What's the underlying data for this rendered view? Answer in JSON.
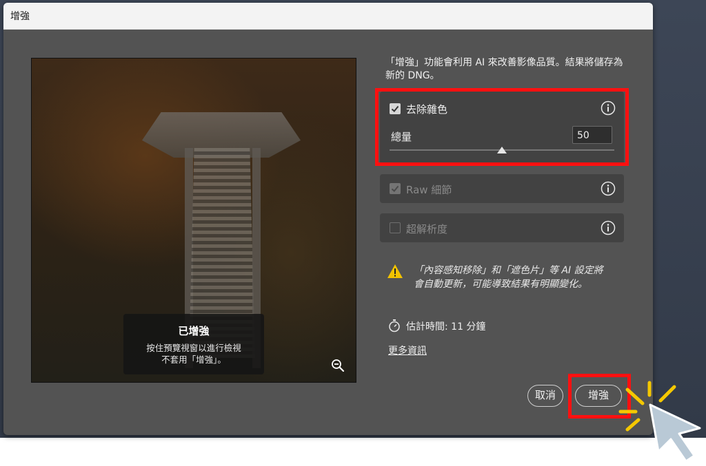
{
  "dialog": {
    "title": "增強"
  },
  "preview": {
    "badge_title": "已增強",
    "badge_subtitle_line1": "按住預覽視窗以進行檢視",
    "badge_subtitle_line2": "不套用「增強」。"
  },
  "description": "「增強」功能會利用 AI 來改善影像品質。結果將儲存為新的 DNG。",
  "options": {
    "denoise": {
      "label": "去除雜色",
      "checked": true,
      "enabled": true,
      "amount_label": "總量",
      "amount_value": "50",
      "slider_percent": 50
    },
    "raw_details": {
      "label": "Raw 細節",
      "checked": true,
      "enabled": false
    },
    "super_resolution": {
      "label": "超解析度",
      "checked": false,
      "enabled": false
    }
  },
  "warning": "「內容感知移除」和「遮色片」等 AI 設定將會自動更新，可能導致結果有明顯變化。",
  "estimate": "估計時間: 11 分鐘",
  "more_info": "更多資訊",
  "buttons": {
    "cancel": "取消",
    "enhance": "增強"
  },
  "colors": {
    "highlight": "#ff1010",
    "dialog_bg": "#535353",
    "panel_bg": "#424242",
    "warning": "#f2c200",
    "sparkle": "#f5c800",
    "cursor": "#b9c9d6"
  },
  "icons": {
    "info": "info-circle-icon",
    "warning": "warning-triangle-icon",
    "timer": "stopwatch-icon",
    "zoom": "zoom-out-icon",
    "check": "checkmark-icon"
  }
}
